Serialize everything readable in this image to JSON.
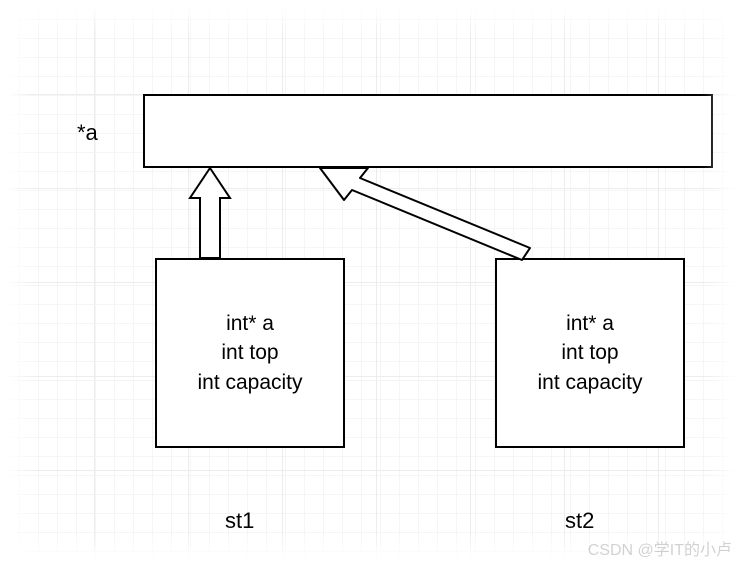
{
  "labels": {
    "pointer_a": "*a",
    "st1": "st1",
    "st2": "st2"
  },
  "struct1": {
    "line1": "int* a",
    "line2": "int top",
    "line3": "int capacity"
  },
  "struct2": {
    "line1": "int* a",
    "line2": "int top",
    "line3": "int capacity"
  },
  "watermark": "CSDN @学IT的小卢"
}
